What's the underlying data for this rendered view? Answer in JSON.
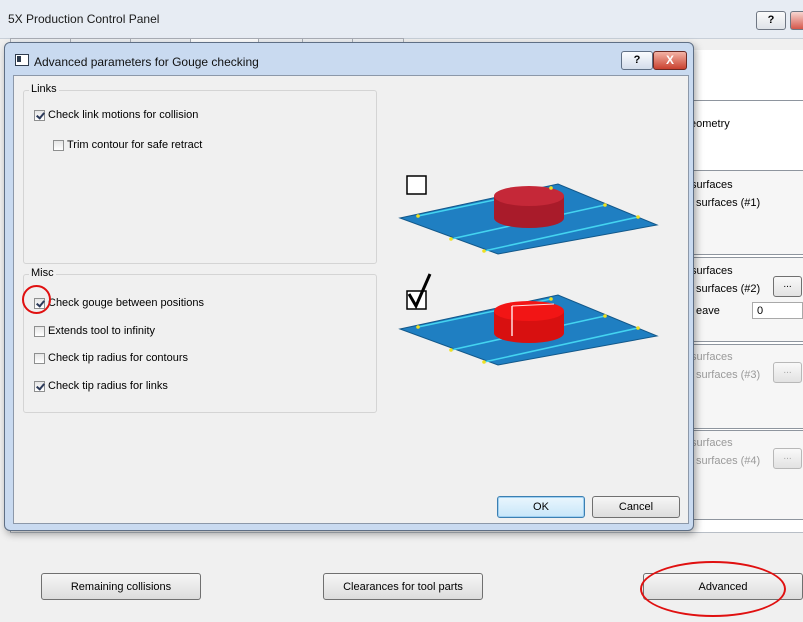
{
  "main_window": {
    "title": "5X Production Control Panel",
    "help_label": "?"
  },
  "right_panel": {
    "geometry_text": "eometry",
    "group1": {
      "line1": "surfaces",
      "line2": "surfaces (#1)"
    },
    "group2": {
      "line1": "surfaces",
      "line2": "surfaces (#2)",
      "btn": "...",
      "leave_label": "eave",
      "leave_value": "0"
    },
    "group3": {
      "line1": "surfaces",
      "line2": "surfaces (#3)",
      "btn": "..."
    },
    "group4": {
      "line1": "surfaces",
      "line2": "surfaces (#4)",
      "btn": "..."
    }
  },
  "bottom_buttons": {
    "remaining": "Remaining collisions",
    "clearances": "Clearances for tool parts",
    "advanced": "Advanced"
  },
  "dialog": {
    "title": "Advanced parameters for Gouge checking",
    "help_label": "?",
    "close_label": "X",
    "links_group": {
      "label": "Links",
      "check_link_motions": "Check link motions for collision",
      "trim_contour": "Trim contour for safe retract"
    },
    "misc_group": {
      "label": "Misc",
      "check_gouge": "Check gouge between positions",
      "extends_tool": "Extends tool to infinity",
      "tip_radius_contours": "Check tip radius for contours",
      "tip_radius_links": "Check tip radius for links"
    },
    "ok_label": "OK",
    "cancel_label": "Cancel"
  },
  "colors": {
    "plane": "#1f7fc2",
    "line": "#44d4f0",
    "cylinder_off": "#b51d2b",
    "cylinder_on": "#e81010",
    "highlight_ellipse": "#e01010"
  }
}
